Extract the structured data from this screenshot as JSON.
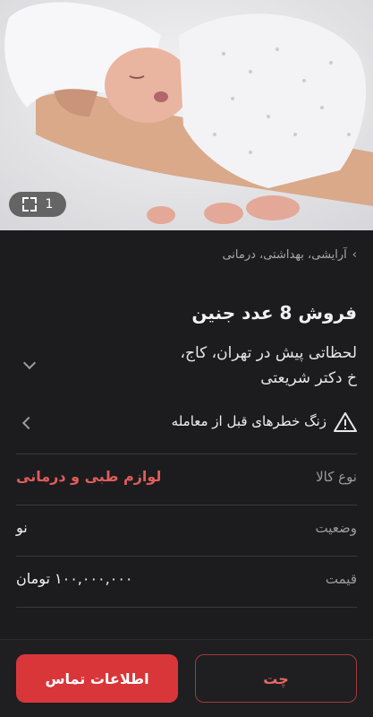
{
  "hero": {
    "image_counter": "1"
  },
  "breadcrumb": {
    "category": "آرایشی، بهداشتی، درمانی"
  },
  "listing": {
    "title": "فروش 8 عدد جنین",
    "location": "لحظاتی پیش در تهران، کاج، خ دکتر شریعتی"
  },
  "warning": {
    "text": "زنگ خطرهای قبل از معامله"
  },
  "details": [
    {
      "label": "نوع کالا",
      "value": "لوازم طبی و درمانی"
    },
    {
      "label": "وضعیت",
      "value": "نو"
    },
    {
      "label": "قیمت",
      "value": "۱۰۰,۰۰۰,۰۰۰ تومان"
    }
  ],
  "actions": {
    "contact_label": "اطلاعات تماس",
    "chat_label": "چت"
  },
  "colors": {
    "background": "#1c1c1e",
    "accent_red": "#d9363a",
    "accent_text": "#e05d5a"
  }
}
